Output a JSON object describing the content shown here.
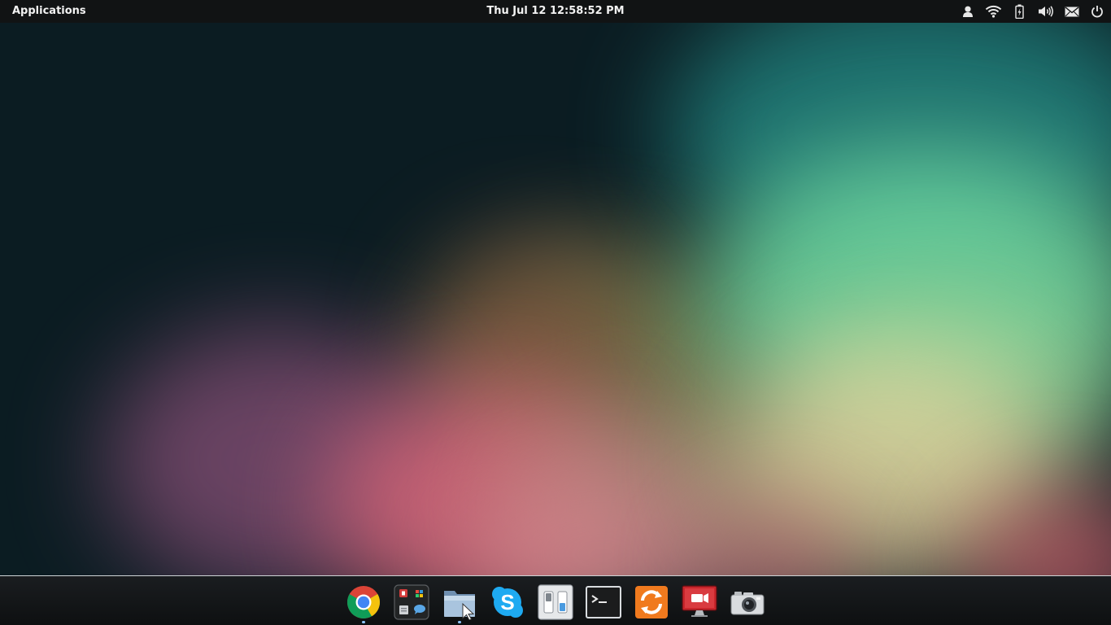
{
  "panel": {
    "applications_label": "Applications",
    "clock_text": "Thu Jul 12 12:58:52 PM"
  },
  "tray_icons": [
    "user-icon",
    "wifi-icon",
    "battery-icon",
    "volume-icon",
    "mail-icon",
    "power-icon"
  ],
  "dock": {
    "items": [
      {
        "icon": "chrome-icon",
        "running": true
      },
      {
        "icon": "app-launcher-icon",
        "running": false
      },
      {
        "icon": "files-icon",
        "running": true
      },
      {
        "icon": "skype-icon",
        "running": false
      },
      {
        "icon": "switchboard-icon",
        "running": false
      },
      {
        "icon": "terminal-icon",
        "running": false
      },
      {
        "icon": "update-manager-icon",
        "running": false
      },
      {
        "icon": "screen-recorder-icon",
        "running": false
      },
      {
        "icon": "screenshot-camera-icon",
        "running": false
      }
    ]
  },
  "colors": {
    "panel_bg": "#111314",
    "dock_border": "#cfd4d7",
    "chrome_red": "#db4437",
    "chrome_yellow": "#f4c20d",
    "chrome_green": "#0f9d58",
    "chrome_blue": "#4285f4",
    "skype_blue": "#1eaaf1",
    "update_orange": "#f07a1e"
  }
}
